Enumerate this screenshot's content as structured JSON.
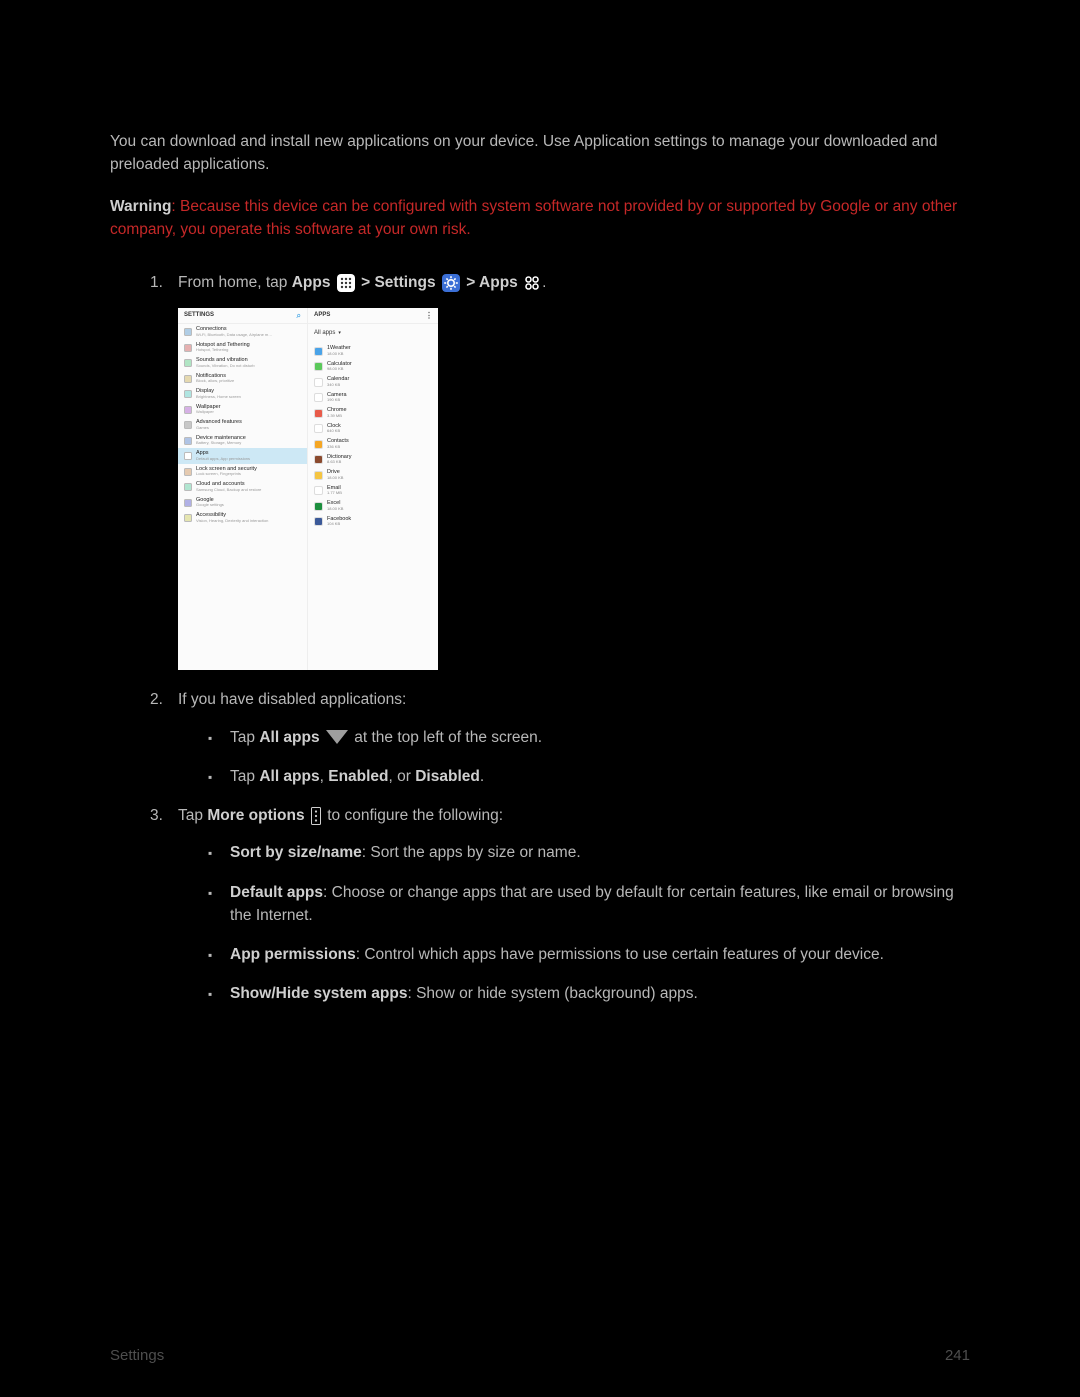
{
  "intro": "You can download and install new applications on your device. Use Application settings to manage your downloaded and preloaded applications.",
  "warning": {
    "label": "Warning",
    "text": ": Because this device can be configured with system software not provided by or supported by Google or any other company, you operate this software at your own risk."
  },
  "step1": {
    "num": "1",
    "prefix": "From home, tap ",
    "apps1": "Apps",
    "sep1": " > ",
    "settings": "Settings",
    "sep2": " > ",
    "apps2": "Apps",
    "suffix": "."
  },
  "step2": {
    "num": "2",
    "text": "If you have disabled applications:"
  },
  "step2b1": {
    "pre": "Tap ",
    "bold": "All apps",
    "post": " at the top left of the screen."
  },
  "step2b2": {
    "pre": "Tap ",
    "b1": "All apps",
    "c1": ", ",
    "b2": "Enabled",
    "c2": ", or ",
    "b3": "Disabled",
    "post": "."
  },
  "step3": {
    "num": "3",
    "pre": "Tap ",
    "bold": "More options",
    "post": " to configure the following:"
  },
  "step3b1": {
    "bold": "Sort by size/name",
    "text": ": Sort the apps by size or name."
  },
  "step3b2": {
    "bold": "Default apps",
    "text": ": Choose or change apps that are used by default for certain features, like email or browsing the Internet."
  },
  "step3b3": {
    "bold": "App permissions",
    "text": ": Control which apps have permissions to use certain features of your device."
  },
  "step3b4": {
    "bold": "Show/Hide system apps",
    "text": ": Show or hide system (background) apps."
  },
  "footer": {
    "left": "Settings",
    "right": "241"
  },
  "shot": {
    "left_header": "SETTINGS",
    "right_header": "APPS",
    "filter": "All apps",
    "settings_list": [
      {
        "title": "Connections",
        "sub": "Wi-Fi, Bluetooth, Data usage, Airplane m…",
        "ico": "#b0cde5"
      },
      {
        "title": "Hotspot and Tethering",
        "sub": "Hotspot, Tethering",
        "ico": "#e5b0b0"
      },
      {
        "title": "Sounds and vibration",
        "sub": "Sounds, Vibration, Do not disturb",
        "ico": "#b0e5c4"
      },
      {
        "title": "Notifications",
        "sub": "Block, allow, prioritize",
        "ico": "#e5d9b0"
      },
      {
        "title": "Display",
        "sub": "Brightness, Home screen",
        "ico": "#b0e5e1"
      },
      {
        "title": "Wallpaper",
        "sub": "Wallpaper",
        "ico": "#d6b0e5"
      },
      {
        "title": "Advanced features",
        "sub": "Games",
        "ico": "#c8c8c8"
      },
      {
        "title": "Device maintenance",
        "sub": "Battery, Storage, Memory",
        "ico": "#b0c4e5"
      },
      {
        "title": "Apps",
        "sub": "Default apps, App permissions",
        "ico": "#fff",
        "sel": true
      },
      {
        "title": "Lock screen and security",
        "sub": "Lock screen, Fingerprints",
        "ico": "#e5cab0"
      },
      {
        "title": "Cloud and accounts",
        "sub": "Samsung Cloud, Backup and restore",
        "ico": "#b0e5d0"
      },
      {
        "title": "Google",
        "sub": "Google settings",
        "ico": "#b0b0e5"
      },
      {
        "title": "Accessibility",
        "sub": "Vision, Hearing, Dexterity and interaction",
        "ico": "#e5e5b0"
      }
    ],
    "apps_list": [
      {
        "name": "1Weather",
        "size": "18.00 KB",
        "color": "#4aa3e8"
      },
      {
        "name": "Calculator",
        "size": "98.00 KB",
        "color": "#5bc95b"
      },
      {
        "name": "Calendar",
        "size": "340 KB",
        "color": "#fff"
      },
      {
        "name": "Camera",
        "size": "190 KB",
        "color": "#fff"
      },
      {
        "name": "Chrome",
        "size": "3.39 MB",
        "color": "#e85b4a"
      },
      {
        "name": "Clock",
        "size": "640 KB",
        "color": "#fff"
      },
      {
        "name": "Contacts",
        "size": "336 KB",
        "color": "#f5a623"
      },
      {
        "name": "Dictionary",
        "size": "8.63 KB",
        "color": "#8b4a2e"
      },
      {
        "name": "Drive",
        "size": "18.00 KB",
        "color": "#f5c542"
      },
      {
        "name": "Email",
        "size": "1.77 MB",
        "color": "#fff"
      },
      {
        "name": "Excel",
        "size": "18.00 KB",
        "color": "#1d8f3e"
      },
      {
        "name": "Facebook",
        "size": "104 KB",
        "color": "#3b5998"
      }
    ]
  }
}
